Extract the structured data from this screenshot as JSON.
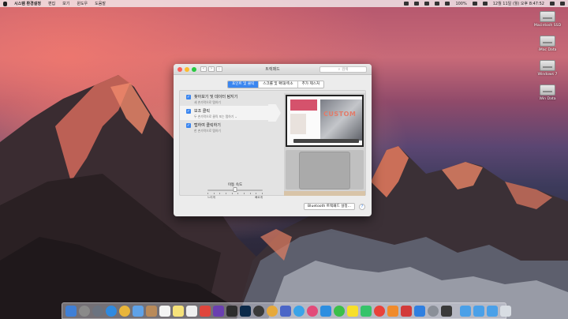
{
  "menubar": {
    "app_name": "시스템 환경설정",
    "menus": [
      "편집",
      "보기",
      "윈도우",
      "도움말"
    ],
    "battery": "100%",
    "clock": "12월 11일 (월) 오후 8:47:52"
  },
  "desktop_icons": [
    {
      "label": "Macintosh SSD"
    },
    {
      "label": "iMac Data"
    },
    {
      "label": "Windows 7"
    },
    {
      "label": "Win Data"
    }
  ],
  "window": {
    "title": "트랙패드",
    "search_placeholder": "검색",
    "tabs": [
      {
        "label": "포인트 및 클릭",
        "active": true
      },
      {
        "label": "스크롤 및 확대/축소",
        "active": false
      },
      {
        "label": "추가 제스처",
        "active": false
      }
    ],
    "options": [
      {
        "title": "찾아보기 및 데이터 탐지기",
        "subtitle": "세 손가락으로 탭하기",
        "checked": true
      },
      {
        "title": "보조 클릭",
        "subtitle": "두 손가락으로 클릭 또는 탭하기 ⌄",
        "checked": true,
        "selected": true
      },
      {
        "title": "탭하여 클릭하기",
        "subtitle": "한 손가락으로 탭하기",
        "checked": true
      }
    ],
    "tracking_speed": {
      "label": "이동 속도",
      "min_label": "느리게",
      "max_label": "빠르게",
      "value_fraction": 0.5
    },
    "preview_text": "CUSTOM",
    "bluetooth_button": "Bluetooth 트랙패드 설정...",
    "help_label": "?"
  },
  "colors": {
    "accent": "#3b86f0"
  }
}
